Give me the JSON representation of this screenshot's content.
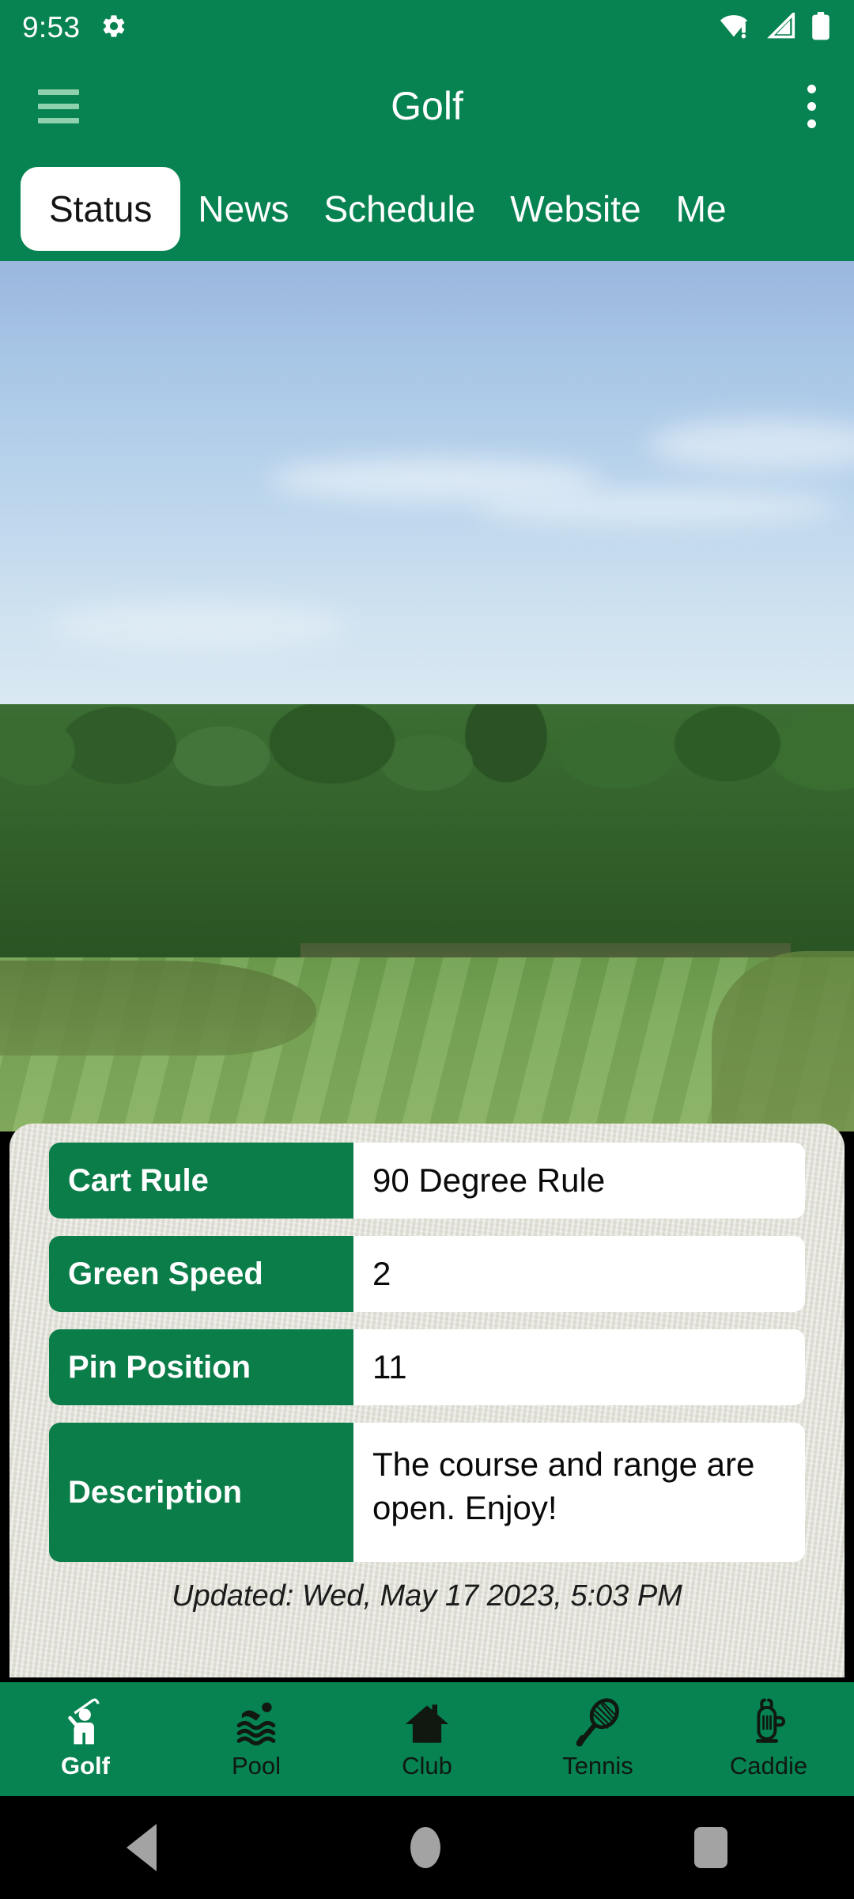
{
  "status_bar": {
    "time": "9:53",
    "icons": [
      "settings-gear",
      "wifi-no-internet",
      "cellular-signal",
      "battery-full"
    ]
  },
  "app_bar": {
    "title": "Golf",
    "menu_icon": "hamburger-menu",
    "overflow_icon": "more-vertical"
  },
  "tabs": [
    {
      "label": "Status",
      "active": true
    },
    {
      "label": "News",
      "active": false
    },
    {
      "label": "Schedule",
      "active": false
    },
    {
      "label": "Website",
      "active": false
    },
    {
      "label": "Me",
      "active": false
    }
  ],
  "hero": {
    "alt": "golf-course-fairway-photo"
  },
  "status_card": {
    "rows": [
      {
        "label": "Cart Rule",
        "value": "90 Degree Rule"
      },
      {
        "label": "Green Speed",
        "value": "2"
      },
      {
        "label": "Pin Position",
        "value": "11"
      },
      {
        "label": "Description",
        "value": "The course and range are open. Enjoy!"
      }
    ],
    "updated": "Updated: Wed, May 17 2023, 5:03 PM"
  },
  "bottom_nav": [
    {
      "label": "Golf",
      "icon": "golfer-icon",
      "active": true
    },
    {
      "label": "Pool",
      "icon": "swimmer-icon",
      "active": false
    },
    {
      "label": "Club",
      "icon": "house-icon",
      "active": false
    },
    {
      "label": "Tennis",
      "icon": "racket-icon",
      "active": false
    },
    {
      "label": "Caddie",
      "icon": "golf-bag-icon",
      "active": false
    }
  ],
  "android_nav": {
    "back": "back-triangle",
    "home": "home-circle",
    "recents": "recents-square"
  },
  "colors": {
    "brand_green": "#068350",
    "label_green": "#0B7D49",
    "card_bg": "#E7E6DE",
    "tab_active_text": "#141414"
  }
}
